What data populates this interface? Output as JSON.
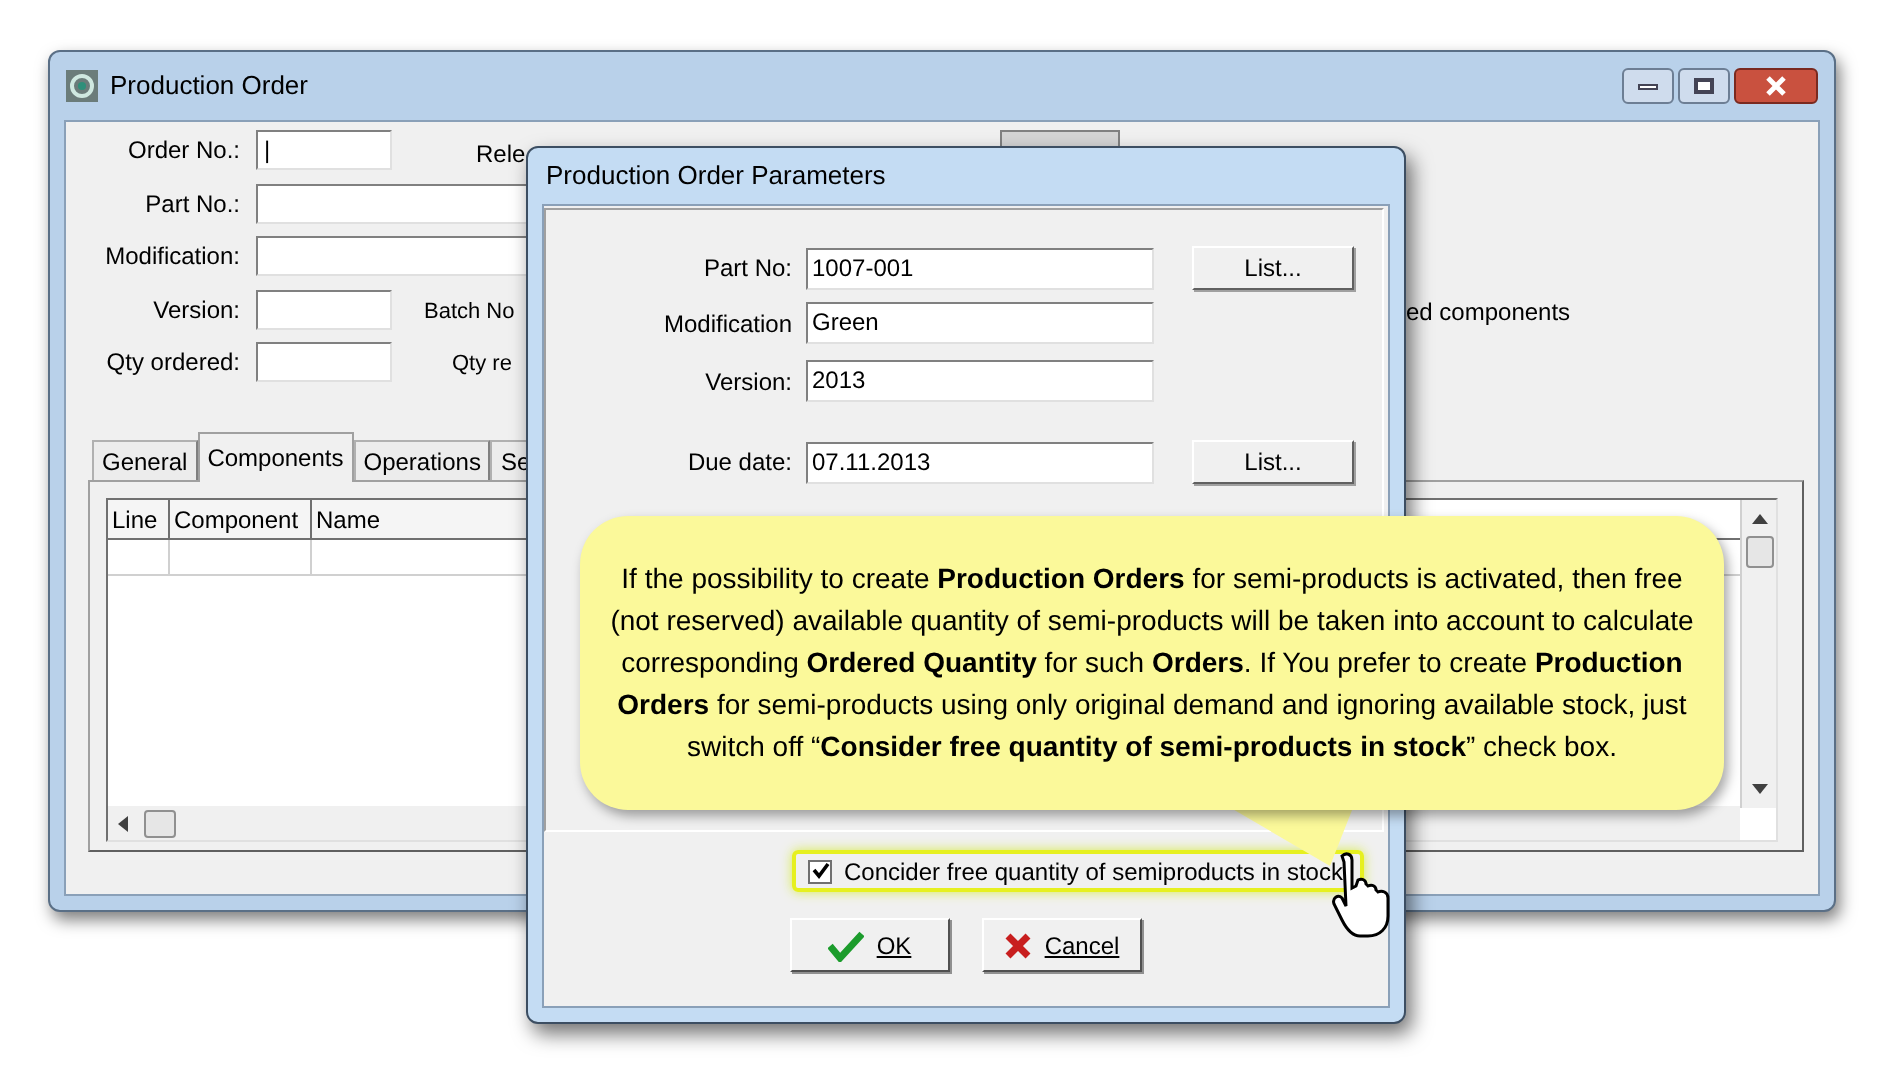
{
  "main_window": {
    "title": "Production Order",
    "fields": [
      {
        "label": "Order No.:",
        "value": "|"
      },
      {
        "label": "Part No.:"
      },
      {
        "label": "Modification:"
      },
      {
        "label": "Version:"
      },
      {
        "label": "Qty ordered:"
      }
    ],
    "partial_labels": [
      "Rele",
      "Batch No",
      "Qty re"
    ],
    "partial_checkbox_label": "ed components",
    "tabs": [
      {
        "label": "General",
        "selected": false
      },
      {
        "label": "Components",
        "selected": true
      },
      {
        "label": "Operations",
        "selected": false
      },
      {
        "label": "Se",
        "selected": false
      }
    ],
    "table": {
      "columns": [
        "Line",
        "Component",
        "Name"
      ]
    }
  },
  "dialog": {
    "title": "Production Order Parameters",
    "fields": [
      {
        "label": "Part No:",
        "value": "1007-001",
        "button": "List..."
      },
      {
        "label": "Modification",
        "value": "Green"
      },
      {
        "label": "Version:",
        "value": "2013"
      },
      {
        "label": "Due date:",
        "value": "07.11.2013",
        "button": "List..."
      }
    ],
    "checkbox": {
      "label": "Concider free quantity of semiproducts in stock",
      "checked": true
    },
    "buttons": [
      {
        "kind": "ok",
        "label": "OK"
      },
      {
        "kind": "cancel",
        "label": "Cancel"
      }
    ]
  },
  "callout": {
    "text": "If the possibility to create **Production  Orders** for semi-products is activated, then free (not reserved) available quantity of semi-products will be taken into account to calculate corresponding **Ordered Quantity** for such **Orders**. If You prefer to create **Production Orders** for semi-products using only original demand and ignoring available stock, just switch off “**Consider free quantity of semi-products in stock**” check box."
  }
}
